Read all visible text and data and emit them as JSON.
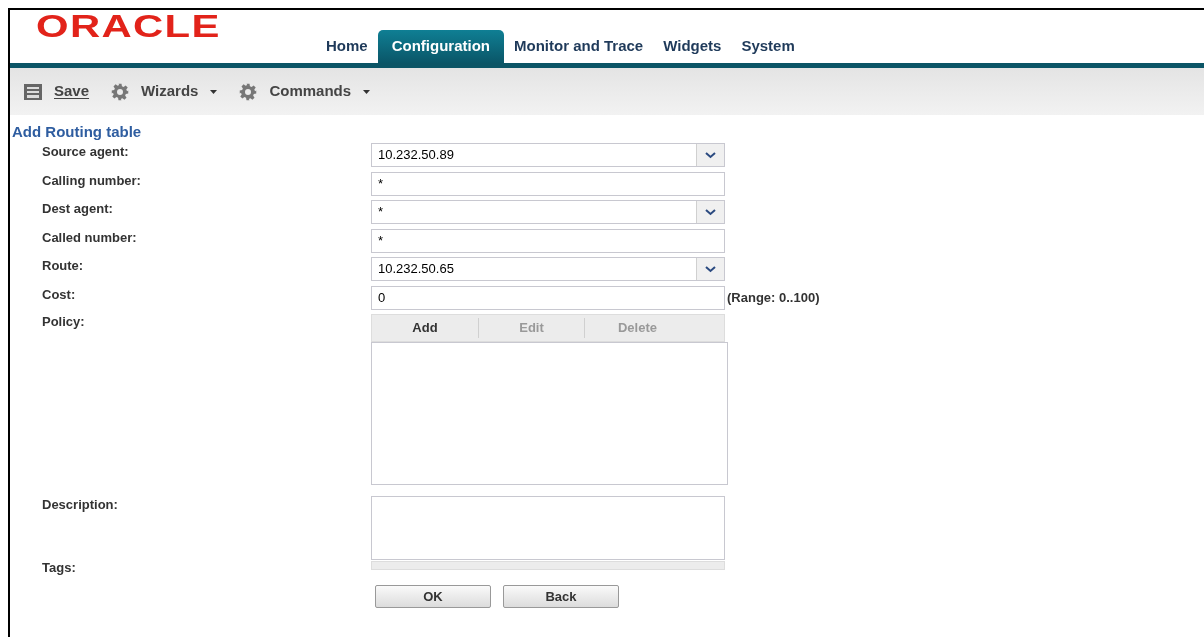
{
  "logo": "ORACLE",
  "tabs": [
    {
      "label": "Home",
      "selected": false
    },
    {
      "label": "Configuration",
      "selected": true
    },
    {
      "label": "Monitor and Trace",
      "selected": false
    },
    {
      "label": "Widgets",
      "selected": false
    },
    {
      "label": "System",
      "selected": false
    }
  ],
  "toolbar": [
    {
      "kind": "save",
      "label": "Save",
      "menu": false
    },
    {
      "kind": "gear",
      "label": "Wizards",
      "menu": true
    },
    {
      "kind": "gear",
      "label": "Commands",
      "menu": true
    }
  ],
  "form": {
    "title": "Add Routing table",
    "fields": [
      {
        "label": "Source agent:",
        "kind": "select",
        "value": "10.232.50.89"
      },
      {
        "label": "Calling number:",
        "kind": "text",
        "value": "*"
      },
      {
        "label": "Dest agent:",
        "kind": "select",
        "value": "*"
      },
      {
        "label": "Called number:",
        "kind": "text",
        "value": "*"
      },
      {
        "label": "Route:",
        "kind": "select",
        "value": "10.232.50.65"
      },
      {
        "label": "Cost:",
        "kind": "text",
        "value": "0",
        "hint": "(Range: 0..100)"
      }
    ],
    "policy": {
      "label": "Policy:",
      "actions": [
        {
          "label": "Add",
          "disabled": false
        },
        {
          "label": "Edit",
          "disabled": true
        },
        {
          "label": "Delete",
          "disabled": true
        }
      ]
    },
    "description": {
      "label": "Description:"
    },
    "tags": {
      "label": "Tags:"
    }
  },
  "buttons": [
    "OK",
    "Back"
  ]
}
